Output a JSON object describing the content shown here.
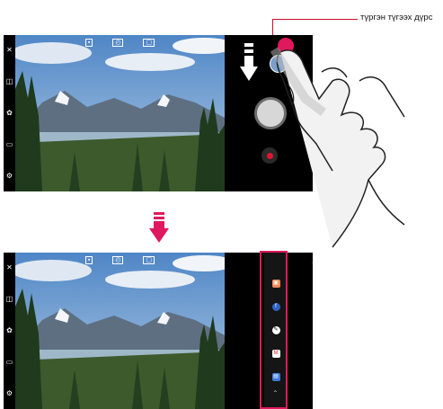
{
  "callout": {
    "label": "түргэн түгээх дүрс"
  },
  "colors": {
    "accent": "#e0185d",
    "record": "#e0152d",
    "arrow": "#e0185d"
  },
  "top_screen": {
    "left_icons": [
      "flash-off-icon",
      "camera-switch-icon",
      "filter-icon",
      "mode-icon",
      "settings-icon"
    ],
    "top_icons": [
      "hdr-icon",
      "timer-icon",
      "ratio-icon"
    ]
  },
  "bottom_screen": {
    "shortcuts": [
      "gallery-app-icon",
      "facebook-app-icon",
      "edit-app-icon",
      "gmail-app-icon",
      "messages-app-icon"
    ]
  }
}
